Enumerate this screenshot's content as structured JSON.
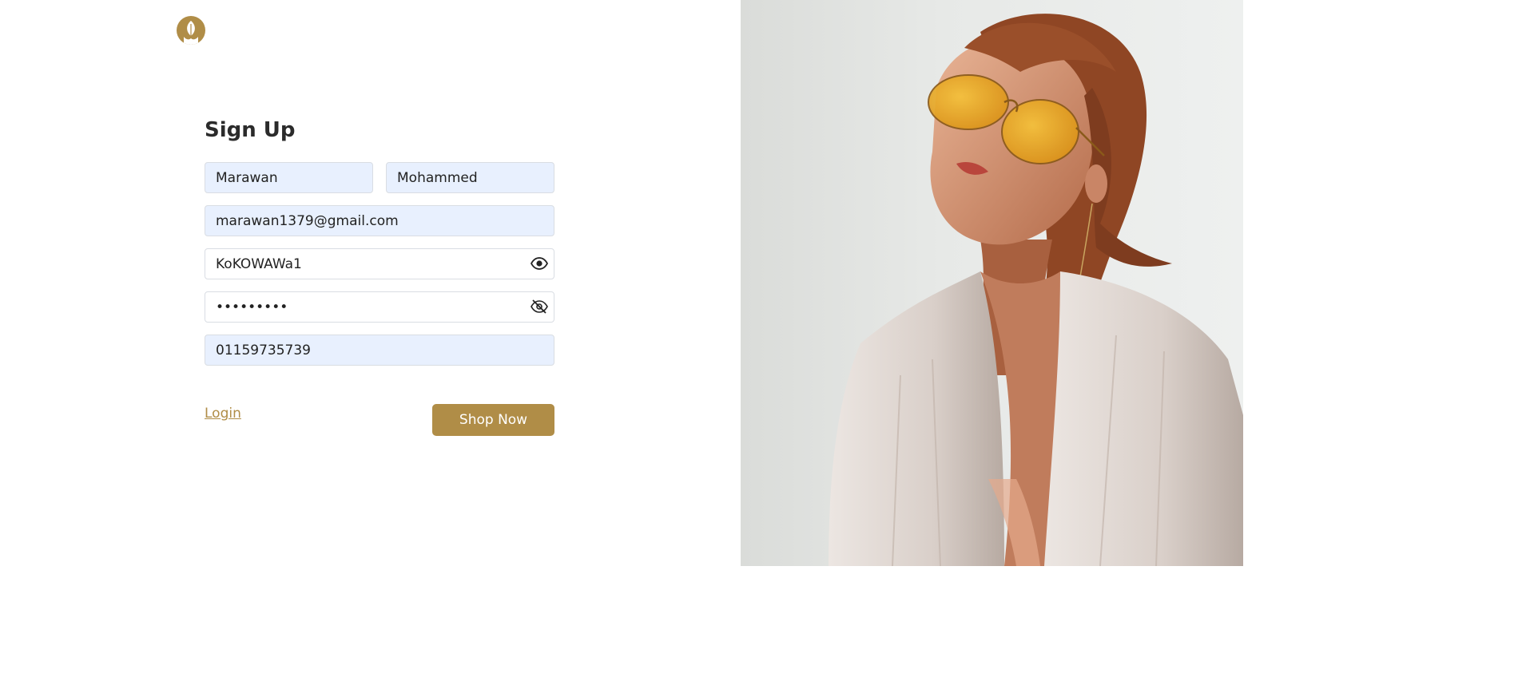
{
  "brand": {
    "logo_icon": "leaf-hand-icon",
    "color": "#b08d47"
  },
  "form": {
    "title": "Sign Up",
    "first_name": {
      "value": "Marawan"
    },
    "last_name": {
      "value": "Mohammed"
    },
    "email": {
      "value": "marawan1379@gmail.com"
    },
    "password": {
      "value": "KoKOWAWa1",
      "visible": true,
      "toggle_icon": "eye-icon"
    },
    "confirm_password": {
      "value": "•••••••••",
      "visible": false,
      "toggle_icon": "eye-slash-icon"
    },
    "phone": {
      "value": "01159735739"
    },
    "login_link": "Login",
    "submit_label": "Shop Now"
  },
  "hero": {
    "image": "model-with-yellow-sunglasses-photo"
  },
  "colors": {
    "accent": "#b08d47",
    "autofill_bg": "#e8f0fe",
    "border": "#d9dde3"
  }
}
